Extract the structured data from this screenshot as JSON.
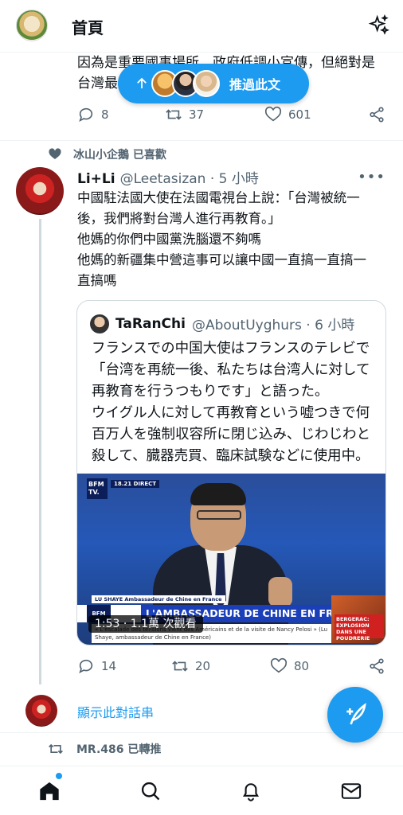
{
  "header": {
    "title": "首頁"
  },
  "top_tweet": {
    "text_line1": "因為是重要國事場所，政府低調小宣傳，但絕對是",
    "text_line2": "台灣最",
    "replies": "8",
    "retweets": "37",
    "likes": "601"
  },
  "new_posts_pill": {
    "label": "推過此文"
  },
  "liked_tweet": {
    "social_context": "冰山小企鵝 已喜歡",
    "author_name": "Li+Li",
    "handle_time": "@Leetasizan · 5 小時",
    "body": [
      "中國駐法國大使在法國電視台上說：「台灣被統一",
      "後，我們將對台灣人進行再教育。」",
      "他媽的你們中國黨洗腦還不夠嗎",
      "他媽的新疆集中營這事可以讓中國一直搞一直搞一",
      "直搞嗎"
    ],
    "replies": "14",
    "retweets": "20",
    "likes": "80"
  },
  "quoted_tweet": {
    "author_name": "TaRanChi",
    "handle_time": "@AboutUyghurs · 6 小時",
    "body": [
      "フランスでの中国大使はフランスのテレビで",
      "「台湾を再統一後、私たちは台湾人に対して",
      "再教育を行うつもりです」と語った。",
      "ウイグル人に対して再教育という嘘つきで何",
      "百万人を強制収容所に閉じ込み、じわじわと",
      "殺して、臓器売買、臨床試験などに使用中。"
    ],
    "video": {
      "bfm_logo": "BFM TV.",
      "bfm_badge": "18.21 DIRECT",
      "speaker": "LU SHAYE  Ambassadeur de Chine en France",
      "headline": "L'AMBASSADEUR DE CHINE EN FRANCE SUR BFMTV",
      "band_logo": "BFM TV.",
      "quote": "« L'escalade des tensions vient des Américains et de la visite de Nancy Pelosi » (Lu Shaye, ambassadeur de Chine en France)",
      "side_text": "BERGERAC: EXPLOSION DANS UNE POUDRERIE",
      "view_chip": "1:53 · 1.1萬 次觀看"
    }
  },
  "show_thread": {
    "label": "顯示此對話串"
  },
  "retweet_row": {
    "label": "MR.486 已轉推"
  },
  "icons": {
    "sparkle": "sparkle-icon",
    "reply": "reply-icon",
    "retweet": "retweet-icon",
    "like": "heart-icon",
    "share": "share-icon",
    "compose": "compose-icon",
    "home": "home-icon",
    "search": "search-icon",
    "notifications": "bell-icon",
    "messages": "mail-icon"
  },
  "colors": {
    "accent": "#1d9bf0",
    "text": "#0f1419",
    "secondary": "#536471"
  }
}
